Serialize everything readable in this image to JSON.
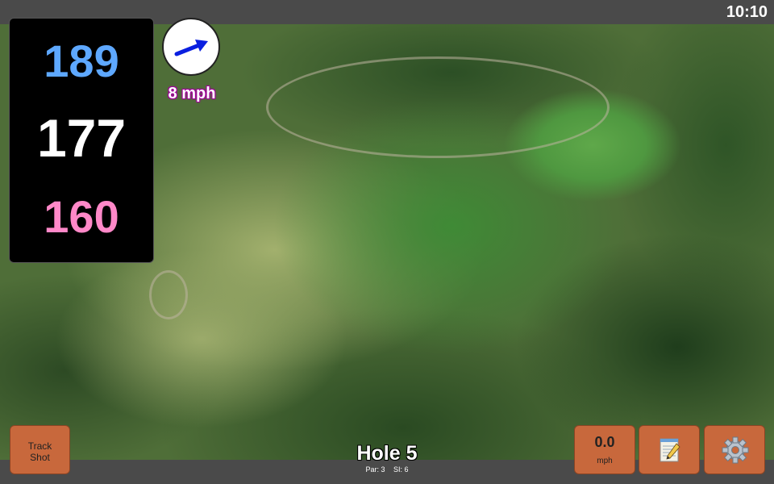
{
  "status": {
    "time": "10:10"
  },
  "distances": {
    "back": "189",
    "center": "177",
    "front": "160"
  },
  "wind": {
    "speed_label": "8 mph",
    "direction_icon": "arrow-east-northeast-icon",
    "arrow_color": "#0a1fe0"
  },
  "hole": {
    "title": "Hole 5",
    "par_label": "Par: 3",
    "si_label": "SI: 6"
  },
  "buttons": {
    "track_shot_line1": "Track",
    "track_shot_line2": "Shot",
    "speed_value": "0.0",
    "speed_unit": "mph",
    "notes_icon": "notepad-icon",
    "settings_icon": "gear-icon"
  },
  "colors": {
    "button_bg": "#c8683c",
    "back_distance": "#5ea8ff",
    "center_distance": "#ffffff",
    "front_distance": "#ff88c8",
    "wind_label_outline": "#a0009a"
  }
}
